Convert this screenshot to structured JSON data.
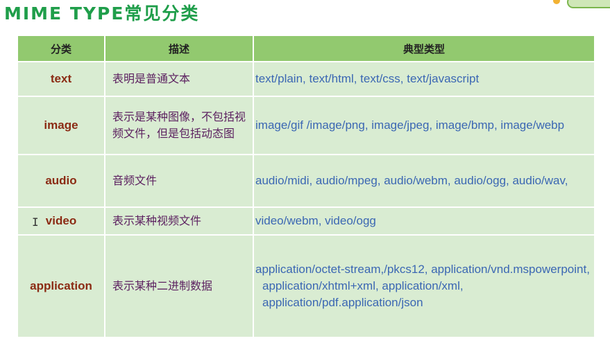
{
  "title": "MIME TYPE常见分类",
  "table": {
    "headers": {
      "category": "分类",
      "description": "描述",
      "types": "典型类型"
    },
    "rows": [
      {
        "category": "text",
        "description": "表明是普通文本",
        "types": "text/plain, text/html, text/css, text/javascript"
      },
      {
        "category": "image",
        "description": "表示是某种图像，不包括视频文件，但是包括动态图",
        "types": "image/gif /image/png, image/jpeg, image/bmp, image/webp"
      },
      {
        "category": "audio",
        "description": "音频文件",
        "types": "audio/midi, audio/mpeg, audio/webm, audio/ogg, audio/wav,"
      },
      {
        "category": "video",
        "description": "表示某种视频文件",
        "types": "video/webm, video/ogg"
      },
      {
        "category": "application",
        "description": "表示某种二进制数据",
        "types": "application/octet-stream,/pkcs12, application/vnd.mspowerpoint, application/xhtml+xml, application/xml, application/pdf.application/json"
      }
    ]
  },
  "colors": {
    "title": "#1f9e4a",
    "header_bg": "#92c96f",
    "row_bg": "#d9ecd2",
    "category_text": "#8b2b14",
    "description_text": "#5b1f5f",
    "types_text": "#3b67b3"
  },
  "cursor": "I"
}
